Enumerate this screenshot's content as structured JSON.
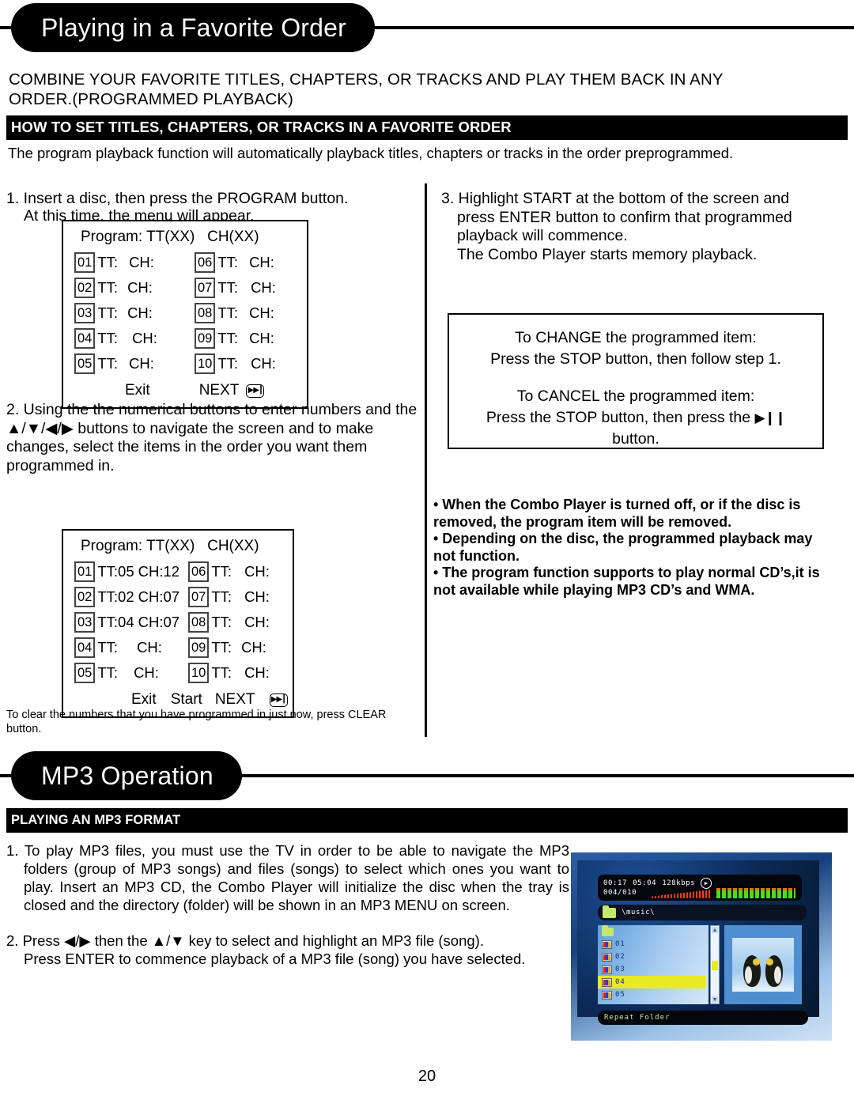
{
  "page": {
    "number": "20"
  },
  "section1": {
    "banner_title": "Playing in a Favorite Order",
    "intro_line1": "COMBINE YOUR FAVORITE TITLES, CHAPTERS, OR TRACKS AND PLAY THEM BACK IN ANY",
    "intro_line2": "ORDER.(PROGRAMMED PLAYBACK)",
    "black_bar": "HOW TO SET TITLES, CHAPTERS, OR TRACKS IN A FAVORITE ORDER",
    "lede": "The program playback function will automatically playback titles, chapters or tracks in the order preprogrammed.",
    "step1_line1": "1. Insert a disc, then press the PROGRAM button.",
    "step1_line2": "At this time, the menu will appear.",
    "step2": "2. Using the the numerical buttons to enter numbers and the ▲/▼/◀/▶ buttons to navigate the screen and to make changes, select the items in the order you want them programmed in.",
    "step3_line1": "3. Highlight START at the bottom of the screen and",
    "step3_line2": "press ENTER button to confirm that programmed",
    "step3_line3": "playback will commence.",
    "step3_line4": "The Combo Player starts memory playback.",
    "clear_caption": "To clear the numbers that you have programmed in just now, press CLEAR button."
  },
  "osd_table_empty": {
    "title": "Program: TT(XX)   CH(XX)",
    "left_rows": [
      {
        "index": "01",
        "tt": "TT:",
        "ch": "CH:"
      },
      {
        "index": "02",
        "tt": "TT:",
        "ch": "CH:"
      },
      {
        "index": "03",
        "tt": "TT:",
        "ch": "CH:"
      },
      {
        "index": "04",
        "tt": "TT:",
        "ch": "CH:"
      },
      {
        "index": "05",
        "tt": "TT:",
        "ch": "CH:"
      }
    ],
    "right_rows": [
      {
        "index": "06",
        "tt": "TT:",
        "ch": "CH:"
      },
      {
        "index": "07",
        "tt": "TT:",
        "ch": "CH:"
      },
      {
        "index": "08",
        "tt": "TT:",
        "ch": "CH:"
      },
      {
        "index": "09",
        "tt": "TT:",
        "ch": "CH:"
      },
      {
        "index": "10",
        "tt": "TT:",
        "ch": "CH:"
      }
    ],
    "exit_label": "Exit",
    "next_label": "NEXT",
    "next_icon": "skip-next-icon"
  },
  "osd_table_filled": {
    "title": "Program: TT(XX)   CH(XX)",
    "left_rows": [
      {
        "index": "01",
        "tt": "TT:05",
        "ch": "CH:12"
      },
      {
        "index": "02",
        "tt": "TT:02",
        "ch": "CH:07"
      },
      {
        "index": "03",
        "tt": "TT:04",
        "ch": "CH:07"
      },
      {
        "index": "04",
        "tt": "TT:",
        "ch": "CH:"
      },
      {
        "index": "05",
        "tt": "TT:",
        "ch": "CH:"
      }
    ],
    "right_rows": [
      {
        "index": "06",
        "tt": "TT:",
        "ch": "CH:"
      },
      {
        "index": "07",
        "tt": "TT:",
        "ch": "CH:"
      },
      {
        "index": "08",
        "tt": "TT:",
        "ch": "CH:"
      },
      {
        "index": "09",
        "tt": "TT:",
        "ch": "CH:"
      },
      {
        "index": "10",
        "tt": "TT:",
        "ch": "CH:"
      }
    ],
    "exit_label": "Exit",
    "start_label": "Start",
    "next_label": "NEXT",
    "next_icon": "skip-next-icon"
  },
  "notebox": {
    "line1": "To CHANGE the programmed item:",
    "line2": "Press the STOP button, then follow step 1.",
    "line3": "To CANCEL the programmed item:",
    "line4_pre": "Press the STOP button, then press the ",
    "line4_icon": "▶❙❙",
    "line5": "button."
  },
  "bullets": {
    "b1": "• When the Combo Player is turned off, or if the disc is removed, the program item will be removed.",
    "b2": "• Depending on the disc, the programmed playback may not function.",
    "b3": "• The program function supports to play normal CD’s,it is not available while playing MP3 CD’s and WMA."
  },
  "section2": {
    "banner_title": "MP3 Operation",
    "black_bar": "PLAYING AN MP3 FORMAT",
    "step1": "1. To play MP3 files, you must use the TV in order to be able to navigate the MP3 folders (group of MP3 songs) and files (songs) to select which ones you want to play. Insert an MP3 CD, the Combo Player will initialize the disc when the tray is closed and the directory (folder) will be shown in an MP3 MENU on screen.",
    "step2_line1_pre": "2. Press ",
    "step2_arrows_lr": "◀/▶",
    "step2_line1_mid": " then the ",
    "step2_arrows_ud": "▲/▼",
    "step2_line1_post": " key to select and highlight an MP3 file (song).",
    "step2_line2": "Press ENTER to commence playback of a MP3 file (song) you have selected."
  },
  "tv_screen": {
    "elapsed_time": "00:17",
    "total_time": "05:04",
    "bitrate": "128kbps",
    "play_glyph": "▶",
    "track_counter": "004/010",
    "folder_path": "\\music\\",
    "list": [
      {
        "label": "",
        "icon": "folder-up-icon",
        "selected": false
      },
      {
        "label": "01",
        "icon": "mp3-file-icon",
        "selected": false
      },
      {
        "label": "02",
        "icon": "mp3-file-icon",
        "selected": false
      },
      {
        "label": "03",
        "icon": "mp3-file-icon",
        "selected": false
      },
      {
        "label": "04",
        "icon": "mp3-file-icon",
        "selected": true
      },
      {
        "label": "05",
        "icon": "mp3-file-icon",
        "selected": false
      }
    ],
    "status_text": "Repeat Folder",
    "scroll_up": "▲",
    "scroll_down": "▼",
    "colors": {
      "highlight": "#e9ea24",
      "folder": "#c4e86b",
      "bar_green": "#46e018",
      "bar_red": "#ff3b17"
    }
  }
}
